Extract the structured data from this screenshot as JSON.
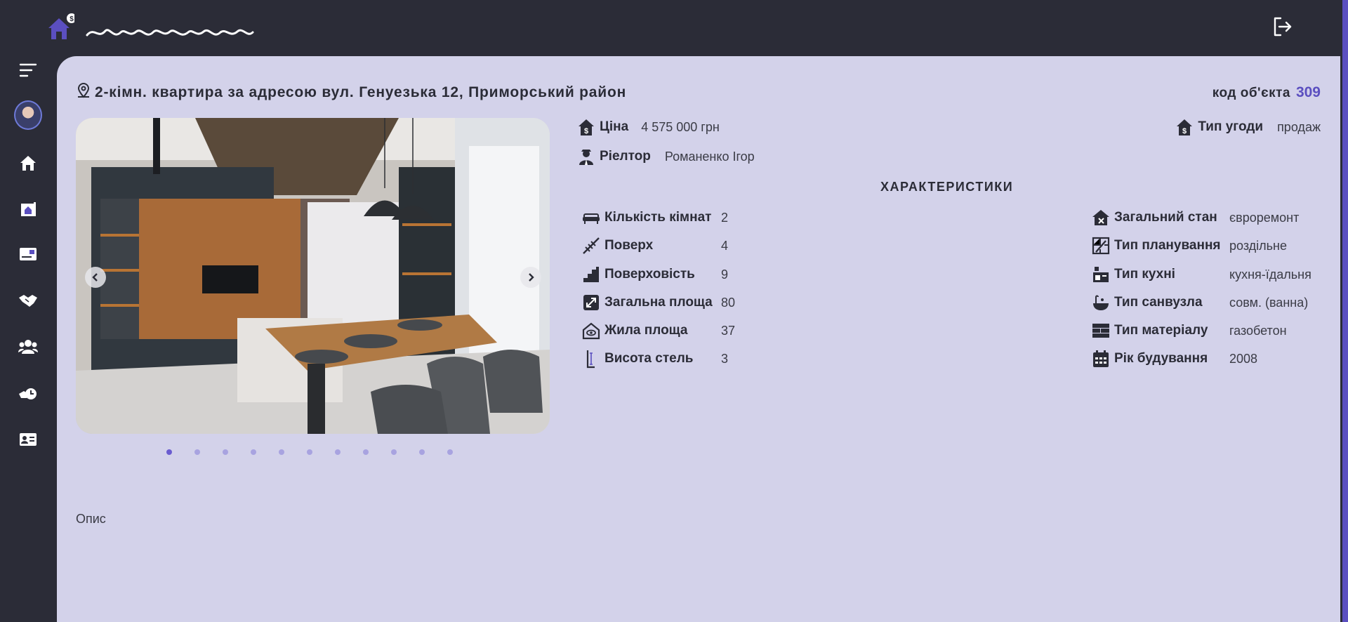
{
  "header": {
    "logo_badge": "$",
    "logo_icon": "house-dollar-icon",
    "logout_icon": "logout-icon"
  },
  "sidebar": {
    "items": [
      {
        "name": "menu-toggle",
        "icon": "menu-icon"
      },
      {
        "name": "profile",
        "icon": "avatar"
      },
      {
        "name": "objects",
        "icon": "house-icon"
      },
      {
        "name": "listings",
        "icon": "house-doc-icon"
      },
      {
        "name": "cards",
        "icon": "id-card-icon"
      },
      {
        "name": "deals",
        "icon": "handshake-icon"
      },
      {
        "name": "clients",
        "icon": "users-icon"
      },
      {
        "name": "history",
        "icon": "clock-hand-icon"
      },
      {
        "name": "contacts",
        "icon": "contact-card-icon"
      }
    ]
  },
  "property": {
    "title": "2-кімн. квартира за адресою вул. Генуезька 12, Приморський район",
    "code_label": "код об'єкта",
    "code_value": "309",
    "price_label": "Ціна",
    "price_value": "4 575 000 грн",
    "realtor_label": "Ріелтор",
    "realtor_value": "Романенко Ігор",
    "deal_type_label": "Тип угоди",
    "deal_type_value": "продаж"
  },
  "characteristics": {
    "title": "ХАРАКТЕРИСТИКИ",
    "left": [
      {
        "label": "Кількість кімнат",
        "value": "2",
        "icon": "sofa-icon"
      },
      {
        "label": "Поверх",
        "value": "4",
        "icon": "stairs-icon"
      },
      {
        "label": "Поверховість",
        "value": "9",
        "icon": "steps-icon"
      },
      {
        "label": "Загальна площа",
        "value": "80",
        "icon": "area-icon"
      },
      {
        "label": "Жила площа",
        "value": "37",
        "icon": "house-eye-icon"
      },
      {
        "label": "Висота стель",
        "value": "3",
        "icon": "ceiling-height-icon"
      }
    ],
    "right": [
      {
        "label": "Загальний стан",
        "value": "євроремонт",
        "icon": "house-tools-icon"
      },
      {
        "label": "Тип планування",
        "value": "роздільне",
        "icon": "blueprint-icon"
      },
      {
        "label": "Тип кухні",
        "value": "кухня-їдальня",
        "icon": "kitchen-icon"
      },
      {
        "label": "Тип санвузла",
        "value": "совм. (ванна)",
        "icon": "bath-icon"
      },
      {
        "label": "Тип матеріалу",
        "value": "газобетон",
        "icon": "bricks-icon"
      },
      {
        "label": "Рік будування",
        "value": "2008",
        "icon": "calendar-icon"
      }
    ]
  },
  "gallery": {
    "image_count": 11,
    "active_index": 0
  },
  "description": {
    "label": "Опис"
  }
}
